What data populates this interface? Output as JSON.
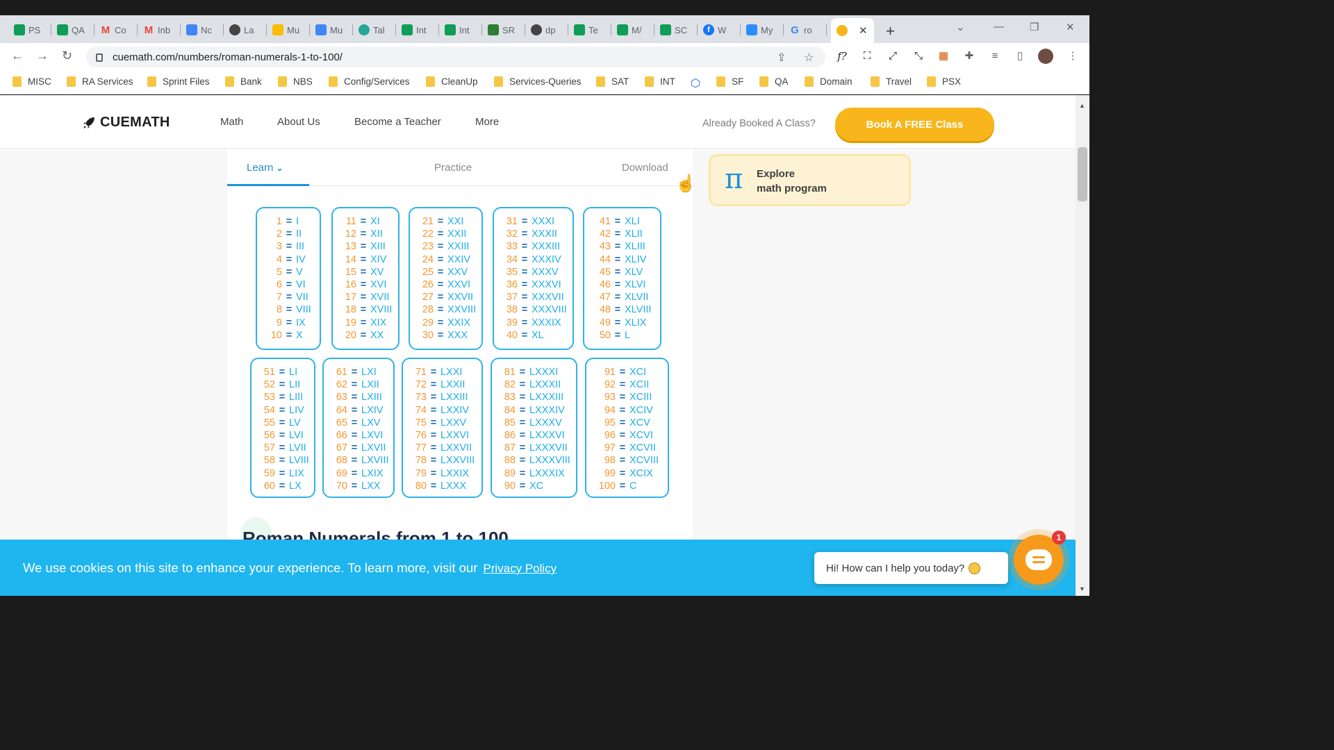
{
  "browser": {
    "tabs": [
      {
        "label": "PS",
        "icon": "sheets-icon",
        "color": "#0f9d58"
      },
      {
        "label": "QA",
        "icon": "sheets-icon",
        "color": "#0f9d58"
      },
      {
        "label": "Co",
        "icon": "gmail-icon",
        "color": "#ea4335"
      },
      {
        "label": "Inb",
        "icon": "gmail-icon",
        "color": "#ea4335"
      },
      {
        "label": "Nc",
        "icon": "calendar-icon",
        "color": "#4285f4"
      },
      {
        "label": "La",
        "icon": "globe-icon",
        "color": "#444444"
      },
      {
        "label": "Mu",
        "icon": "drive-icon",
        "color": "#fbbc04"
      },
      {
        "label": "Mu",
        "icon": "docs-icon",
        "color": "#4285f4"
      },
      {
        "label": "Tal",
        "icon": "talk-icon",
        "color": "#26a69a"
      },
      {
        "label": "Int",
        "icon": "sheets-icon",
        "color": "#0f9d58"
      },
      {
        "label": "Int",
        "icon": "sheets-icon",
        "color": "#0f9d58"
      },
      {
        "label": "SR",
        "icon": "recycle-icon",
        "color": "#2e7d32"
      },
      {
        "label": "dp",
        "icon": "globe-icon",
        "color": "#444444"
      },
      {
        "label": "Te",
        "icon": "sheets-icon",
        "color": "#0f9d58"
      },
      {
        "label": "M/",
        "icon": "sheets-icon",
        "color": "#0f9d58"
      },
      {
        "label": "SC",
        "icon": "sheets-icon",
        "color": "#0f9d58"
      },
      {
        "label": "W",
        "icon": "facebook-icon",
        "color": "#1877f2"
      },
      {
        "label": "My",
        "icon": "zoom-icon",
        "color": "#2d8cff"
      },
      {
        "label": "ro",
        "icon": "google-icon",
        "color": "#4285f4"
      },
      {
        "label": "",
        "icon": "cuemath-icon",
        "color": "#f8b61c",
        "active": true
      }
    ],
    "url": "cuemath.com/numbers/roman-numerals-1-to-100/",
    "bookmarks": [
      "MISC",
      "RA Services",
      "Sprint Files",
      "Bank",
      "NBS",
      "Config/Services",
      "CleanUp",
      "Services-Queries",
      "SAT",
      "INT",
      "",
      "SF",
      "QA",
      "Domain",
      "Travel",
      "PSX"
    ]
  },
  "site": {
    "logo": "CUEMATH",
    "nav": [
      "Math",
      "About Us",
      "Become a Teacher",
      "More"
    ],
    "booked_text": "Already Booked A Class?",
    "cta": "Book A FREE Class",
    "content_tabs": [
      "Learn",
      "Practice",
      "Download"
    ],
    "explore": {
      "line1": "Explore",
      "line2": "math program",
      "icon": "π"
    },
    "heading": "Roman Numerals from 1 to 100",
    "cookie_text": "We use cookies on this site to enhance your experience. To learn more, visit our",
    "cookie_link": "Privacy Policy",
    "chat_text": "Hi! How can I help you today?",
    "chat_badge": "1",
    "colors": {
      "accent": "#1e8fd6",
      "cta": "#f8b61c",
      "number": "#f5962f",
      "roman": "#1eaeea",
      "cookie": "#1fb5ef"
    }
  },
  "numerals": [
    [
      "1",
      "I"
    ],
    [
      "2",
      "II"
    ],
    [
      "3",
      "III"
    ],
    [
      "4",
      "IV"
    ],
    [
      "5",
      "V"
    ],
    [
      "6",
      "VI"
    ],
    [
      "7",
      "VII"
    ],
    [
      "8",
      "VIII"
    ],
    [
      "9",
      "IX"
    ],
    [
      "10",
      "X"
    ],
    [
      "11",
      "XI"
    ],
    [
      "12",
      "XII"
    ],
    [
      "13",
      "XIII"
    ],
    [
      "14",
      "XIV"
    ],
    [
      "15",
      "XV"
    ],
    [
      "16",
      "XVI"
    ],
    [
      "17",
      "XVII"
    ],
    [
      "18",
      "XVIII"
    ],
    [
      "19",
      "XIX"
    ],
    [
      "20",
      "XX"
    ],
    [
      "21",
      "XXI"
    ],
    [
      "22",
      "XXII"
    ],
    [
      "23",
      "XXIII"
    ],
    [
      "24",
      "XXIV"
    ],
    [
      "25",
      "XXV"
    ],
    [
      "26",
      "XXVI"
    ],
    [
      "27",
      "XXVII"
    ],
    [
      "28",
      "XXVIII"
    ],
    [
      "29",
      "XXIX"
    ],
    [
      "30",
      "XXX"
    ],
    [
      "31",
      "XXXI"
    ],
    [
      "32",
      "XXXII"
    ],
    [
      "33",
      "XXXIII"
    ],
    [
      "34",
      "XXXIV"
    ],
    [
      "35",
      "XXXV"
    ],
    [
      "36",
      "XXXVI"
    ],
    [
      "37",
      "XXXVII"
    ],
    [
      "38",
      "XXXVIII"
    ],
    [
      "39",
      "XXXIX"
    ],
    [
      "40",
      "XL"
    ],
    [
      "41",
      "XLI"
    ],
    [
      "42",
      "XLII"
    ],
    [
      "43",
      "XLIII"
    ],
    [
      "44",
      "XLIV"
    ],
    [
      "45",
      "XLV"
    ],
    [
      "46",
      "XLVI"
    ],
    [
      "47",
      "XLVII"
    ],
    [
      "48",
      "XLVIII"
    ],
    [
      "49",
      "XLIX"
    ],
    [
      "50",
      "L"
    ],
    [
      "51",
      "LI"
    ],
    [
      "52",
      "LII"
    ],
    [
      "53",
      "LIII"
    ],
    [
      "54",
      "LIV"
    ],
    [
      "55",
      "LV"
    ],
    [
      "56",
      "LVI"
    ],
    [
      "57",
      "LVII"
    ],
    [
      "58",
      "LVIII"
    ],
    [
      "59",
      "LIX"
    ],
    [
      "60",
      "LX"
    ],
    [
      "61",
      "LXI"
    ],
    [
      "62",
      "LXII"
    ],
    [
      "63",
      "LXIII"
    ],
    [
      "64",
      "LXIV"
    ],
    [
      "65",
      "LXV"
    ],
    [
      "66",
      "LXVI"
    ],
    [
      "67",
      "LXVII"
    ],
    [
      "68",
      "LXVIII"
    ],
    [
      "69",
      "LXIX"
    ],
    [
      "70",
      "LXX"
    ],
    [
      "71",
      "LXXI"
    ],
    [
      "72",
      "LXXII"
    ],
    [
      "73",
      "LXXIII"
    ],
    [
      "74",
      "LXXIV"
    ],
    [
      "75",
      "LXXV"
    ],
    [
      "76",
      "LXXVI"
    ],
    [
      "77",
      "LXXVII"
    ],
    [
      "78",
      "LXXVIII"
    ],
    [
      "79",
      "LXXIX"
    ],
    [
      "80",
      "LXXX"
    ],
    [
      "81",
      "LXXXI"
    ],
    [
      "82",
      "LXXXII"
    ],
    [
      "83",
      "LXXXIII"
    ],
    [
      "84",
      "LXXXIV"
    ],
    [
      "85",
      "LXXXV"
    ],
    [
      "86",
      "LXXXVI"
    ],
    [
      "87",
      "LXXXVII"
    ],
    [
      "88",
      "LXXXVIII"
    ],
    [
      "89",
      "LXXXIX"
    ],
    [
      "90",
      "XC"
    ],
    [
      "91",
      "XCI"
    ],
    [
      "92",
      "XCII"
    ],
    [
      "93",
      "XCIII"
    ],
    [
      "94",
      "XCIV"
    ],
    [
      "95",
      "XCV"
    ],
    [
      "96",
      "XCVI"
    ],
    [
      "97",
      "XCVII"
    ],
    [
      "98",
      "XCVIII"
    ],
    [
      "99",
      "XCIX"
    ],
    [
      "100",
      "C"
    ]
  ]
}
